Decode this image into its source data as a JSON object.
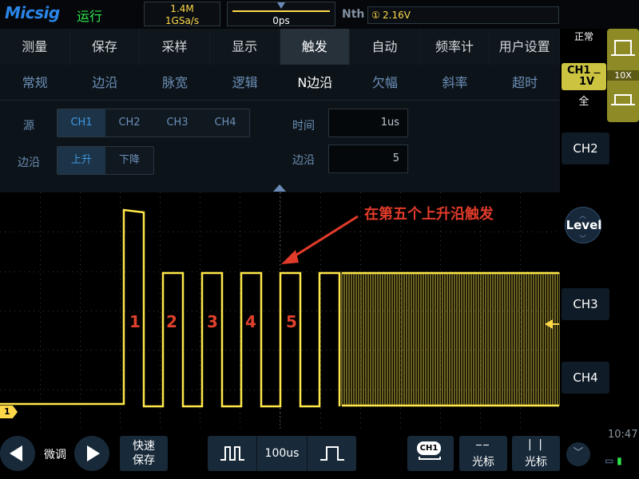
{
  "topbar": {
    "logo": "Micsig",
    "run_status": "运行",
    "memory_depth": "1.4M",
    "sample_rate": "1GSa/s",
    "time_offset": "0ps",
    "nth_label": "Nth",
    "trigger_level_icon": "①",
    "trigger_level": "2.16V"
  },
  "menu": {
    "tabs": [
      "测量",
      "保存",
      "采样",
      "显示",
      "触发",
      "自动",
      "频率计",
      "用户设置"
    ],
    "active_tab": "触发",
    "trigger_types": [
      "常规",
      "边沿",
      "脉宽",
      "逻辑",
      "N边沿",
      "欠幅",
      "斜率",
      "超时"
    ],
    "active_trigger_type": "N边沿",
    "source_label": "源",
    "sources": [
      "CH1",
      "CH2",
      "CH3",
      "CH4"
    ],
    "selected_source": "CH1",
    "edge_label": "边沿",
    "edges": [
      "上升",
      "下降"
    ],
    "selected_edge": "上升",
    "time_label": "时间",
    "time_value": "1us",
    "edge_count_label": "边沿",
    "edge_count_value": "5"
  },
  "scope": {
    "annotation": "在第五个上升沿触发",
    "pulse_labels": [
      "1",
      "2",
      "3",
      "4",
      "5"
    ],
    "channel_marker": "1",
    "trace_color": "#ffe84a",
    "annotation_color": "#e23b2a"
  },
  "right_panel": {
    "mode": "正常",
    "ch1_name": "CH1",
    "ch1_scale": "1V",
    "ch1_coupling": "—",
    "ch1_bandwidth": "全",
    "probe": "10X",
    "ch2": "CH2",
    "ch3": "CH3",
    "ch4": "CH4",
    "level": "Level",
    "clock": "10:47"
  },
  "bottom": {
    "fine_tune": "微调",
    "quick_save_line1": "快速",
    "quick_save_line2": "保存",
    "timebase": "100us",
    "ch1_label": "CH1",
    "cursor_label_1": "光标",
    "cursor_label_2": "光标"
  }
}
